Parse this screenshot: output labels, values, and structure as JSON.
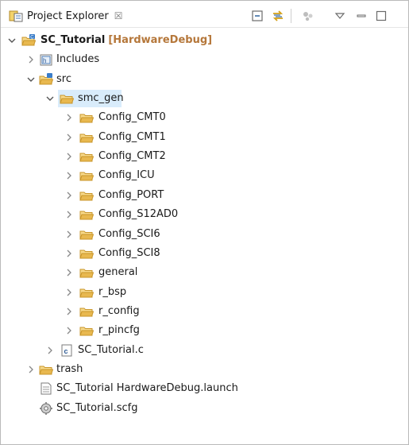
{
  "view": {
    "title": "Project Explorer",
    "close_glyph": "☒"
  },
  "toolbar": {
    "collapse_all": "collapse-all-icon",
    "link_editor": "link-with-editor-icon",
    "filters": "filters-icon",
    "view_menu": "view-menu-icon",
    "minimize": "minimize-icon",
    "maximize": "maximize-icon"
  },
  "tree": {
    "project": {
      "name": "SC_Tutorial",
      "decoration": "[HardwareDebug]"
    },
    "includes": "Includes",
    "src": "src",
    "smc_gen": "smc_gen",
    "smc_children": [
      "Config_CMT0",
      "Config_CMT1",
      "Config_CMT2",
      "Config_ICU",
      "Config_PORT",
      "Config_S12AD0",
      "Config_SCI6",
      "Config_SCI8",
      "general",
      "r_bsp",
      "r_config",
      "r_pincfg"
    ],
    "c_file": "SC_Tutorial.c",
    "trash": "trash",
    "launch_file": "SC_Tutorial HardwareDebug.launch",
    "scfg_file": "SC_Tutorial.scfg"
  },
  "colors": {
    "folder": "#e8b84f",
    "selection": "#d9ecfb",
    "decoration": "#b5773a"
  }
}
